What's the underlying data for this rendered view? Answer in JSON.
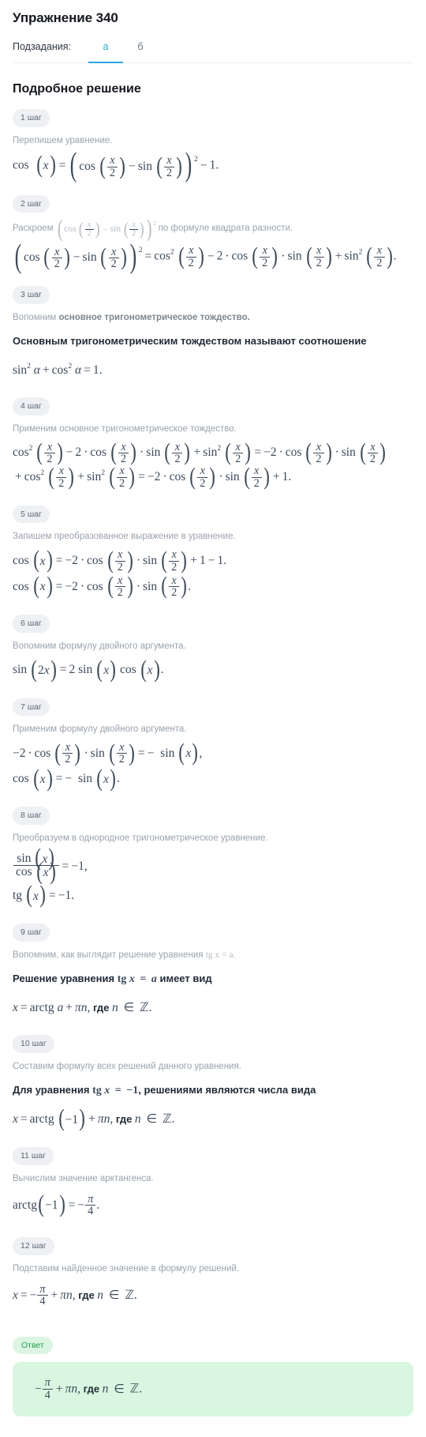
{
  "header": {
    "title": "Упражнение 340",
    "subtasks_label": "Подзадания:",
    "tabs": [
      {
        "label": "а",
        "active": true
      },
      {
        "label": "б",
        "active": false
      }
    ]
  },
  "solution": {
    "section_title": "Подробное решение",
    "answer_badge": "Ответ",
    "answer_text": "−π/4 + πn, где n ∈ ℤ."
  },
  "colors": {
    "accent_blue": "#2aa9e0",
    "badge_bg": "#eef0f3",
    "badge_text": "#5d6774",
    "answer_badge_bg": "#dcf5e3",
    "answer_badge_text": "#23a04f",
    "answer_box_bg": "#d9f7e0",
    "math_text": "#3c4a5c",
    "note_text": "#9aa3ad",
    "heading_text": "#15181f"
  },
  "steps": [
    {
      "badge": "1 шаг",
      "note": "Перепишем уравнение.",
      "formulas": [
        "cos (x) = (cos (x/2) − sin (x/2))² − 1."
      ]
    },
    {
      "badge": "2 шаг",
      "note_prefix": "Раскроем",
      "note_math": "(cos (x/2) − sin (x/2))²",
      "note_suffix": "по формуле квадрата разности.",
      "formulas": [
        "(cos (x/2) − sin (x/2))² = cos² (x/2) − 2 · cos (x/2) · sin (x/2) + sin² (x/2)."
      ]
    },
    {
      "badge": "3 шаг",
      "note_prefix": "Вопомним",
      "note_bold": "основное тригонометрическое тождество.",
      "statement": "Основным тригонометрическим тождеством называют соотношение",
      "formulas": [
        "sin² α + cos² α = 1."
      ]
    },
    {
      "badge": "4 шаг",
      "note": "Применим основное тригонометрическое тождество.",
      "formulas": [
        "cos² (x/2) − 2 · cos (x/2) · sin (x/2) + sin² (x/2) = −2 · cos (x/2) · sin (x/2) + cos² (x/2) + sin² (x/2) = −2 · cos (x/2) · sin (x/2) + 1."
      ]
    },
    {
      "badge": "5 шаг",
      "note": "Запишем преобразованное выражение в уравнение.",
      "formulas": [
        "cos (x) = −2 · cos (x/2) · sin (x/2) + 1 − 1.",
        "cos (x) = −2 · cos (x/2) · sin (x/2)."
      ]
    },
    {
      "badge": "6 шаг",
      "note": "Вопомним формулу двойного аргумента.",
      "formulas": [
        "sin (2x) = 2 sin (x) cos (x)."
      ]
    },
    {
      "badge": "7 шаг",
      "note": "Применим формулу двойного аргумента.",
      "formulas": [
        "−2 · cos (x/2) · sin (x/2) = − sin (x),",
        "cos (x) = − sin (x)."
      ]
    },
    {
      "badge": "8 шаг",
      "note": "Преобразуем в однородное тригонометрическое уравнение.",
      "formulas": [
        "sin (x)/cos (x) = −1,",
        "tg (x) = −1."
      ]
    },
    {
      "badge": "9 шаг",
      "note_prefix": "Вопомним, как выглядит решение уравнения",
      "note_math": "tg x = a.",
      "statement_prefix": "Решение уравнения",
      "statement_math": "tg x = a",
      "statement_suffix": "имеет вид",
      "formulas": [
        "x = arctg a + πn, где n ∈ ℤ."
      ]
    },
    {
      "badge": "10 шаг",
      "note": "Составим формулу всех решений данного уравнения.",
      "statement_prefix": "Для уравнения",
      "statement_math": "tg x = −1",
      "statement_suffix": ", решениями являются числа вида",
      "formulas": [
        "x = arctg (−1) + πn, где n ∈ ℤ."
      ]
    },
    {
      "badge": "11 шаг",
      "note": "Вычислим значение арктангенса.",
      "formulas": [
        "arctg(−1) = −π/4."
      ]
    },
    {
      "badge": "12 шаг",
      "note": "Подставим найденное значение в формулу решений.",
      "formulas": [
        "x = −π/4 + πn, где n ∈ ℤ."
      ]
    }
  ]
}
